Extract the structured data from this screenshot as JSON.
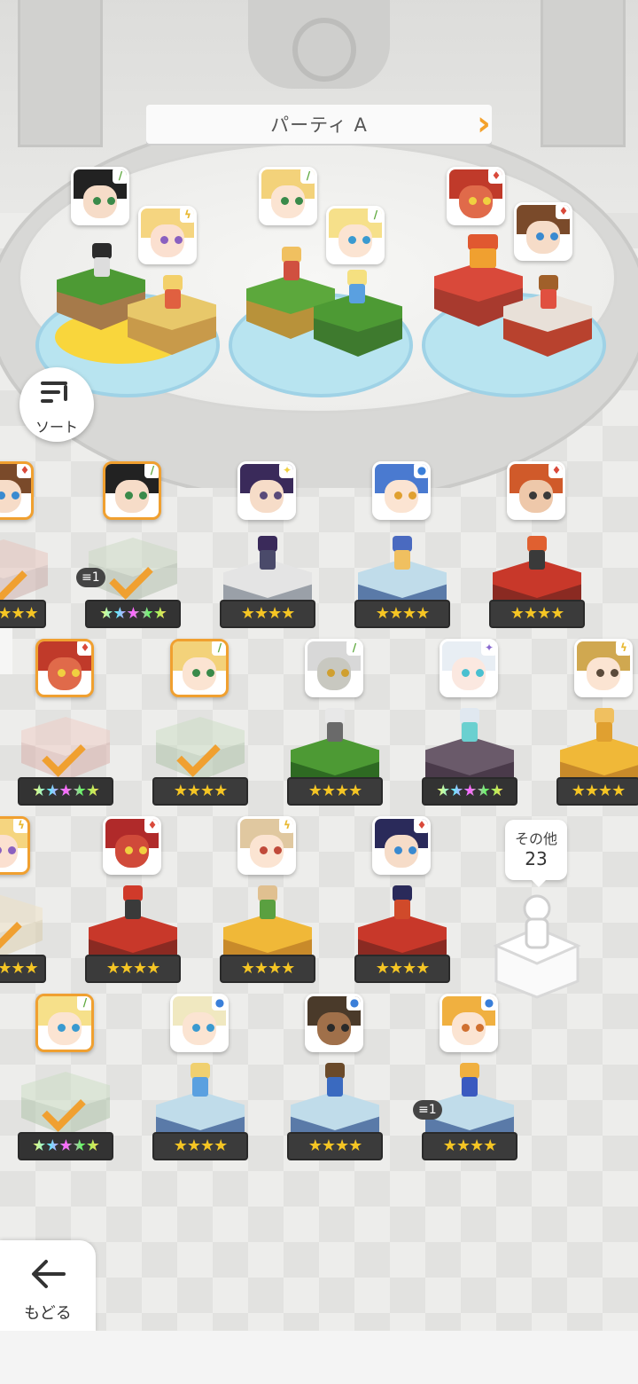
{
  "party": {
    "title": "パーティ A"
  },
  "sort": {
    "label": "ソート"
  },
  "others": {
    "label": "その他",
    "count": "23"
  },
  "back": {
    "label": "もどる"
  },
  "party_slot_badges": [
    "1"
  ],
  "roster": [
    {
      "id": "c1",
      "element": "fire",
      "stars": 3,
      "in_party": true
    },
    {
      "id": "c2",
      "element": "earth",
      "stars": 5,
      "rainbow": true,
      "in_party": true,
      "copies": "1"
    },
    {
      "id": "c3",
      "element": "light",
      "stars": 4
    },
    {
      "id": "c4",
      "element": "water",
      "stars": 4
    },
    {
      "id": "c5",
      "element": "fire",
      "stars": 4
    },
    {
      "id": "c6",
      "element": "fire",
      "stars": 5,
      "rainbow": true,
      "in_party": true
    },
    {
      "id": "c7",
      "element": "earth",
      "stars": 4,
      "in_party": true
    },
    {
      "id": "c8",
      "element": "earth",
      "stars": 4
    },
    {
      "id": "c9",
      "element": "dark",
      "stars": 5,
      "rainbow": true
    },
    {
      "id": "c10",
      "element": "thunder",
      "stars": 4
    },
    {
      "id": "c11",
      "element": "thunder",
      "stars": 3,
      "in_party": true
    },
    {
      "id": "c12",
      "element": "fire",
      "stars": 4
    },
    {
      "id": "c13",
      "element": "thunder",
      "stars": 4
    },
    {
      "id": "c14",
      "element": "fire",
      "stars": 4
    },
    {
      "id": "c15",
      "element": "earth",
      "stars": 5,
      "rainbow": true,
      "in_party": true
    },
    {
      "id": "c16",
      "element": "water",
      "stars": 4
    },
    {
      "id": "c17",
      "element": "water",
      "stars": 4
    },
    {
      "id": "c18",
      "element": "water",
      "stars": 4,
      "copies": "1"
    }
  ],
  "star_text": {
    "three": "★★★",
    "four": "★★★★",
    "five": "★★★★★"
  },
  "element_glyphs": {
    "fire": "♦",
    "earth": "/",
    "thunder": "ϟ",
    "water": "●",
    "light": "✦",
    "dark": "✦"
  },
  "colors": {
    "accent": "#f0a030",
    "fire": "#d9493a",
    "earth": "#5ca83c",
    "thunder": "#e8b830",
    "water": "#3a7fd9",
    "dark": "#8a6ad0",
    "light": "#f0d040"
  }
}
